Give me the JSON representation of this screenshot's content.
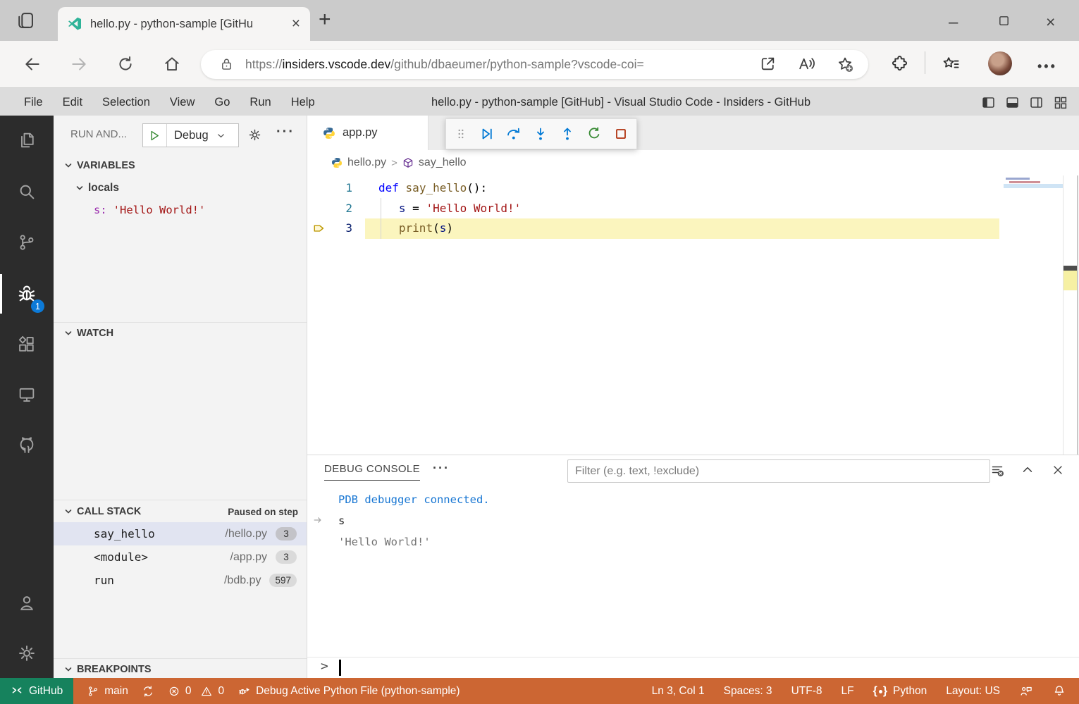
{
  "colors": {
    "status_debugging": "#CC6633",
    "remote_green": "#16825D",
    "badge_blue": "#0C7AD8",
    "current_line_highlight": "#FBF5BE",
    "activity_bar": "#2C2C2C"
  },
  "browser": {
    "tab_title": "hello.py - python-sample [GitHu",
    "new_tab_label": "+",
    "url_scheme": "https://",
    "url_host": "insiders.vscode.dev",
    "url_path": "/github/dbaeumer/python-sample?vscode-coi="
  },
  "titlebar": {
    "menus": [
      "File",
      "Edit",
      "Selection",
      "View",
      "Go",
      "Run",
      "Help"
    ],
    "title": "hello.py - python-sample [GitHub] - Visual Studio Code - Insiders - GitHub"
  },
  "activity_bar": {
    "debug_badge": "1"
  },
  "run_panel": {
    "header_label": "RUN AND...",
    "config_name": "Debug",
    "sections": {
      "variables": "VARIABLES",
      "watch": "WATCH",
      "call_stack": "CALL STACK",
      "breakpoints": "BREAKPOINTS"
    },
    "variables_scope": "locals",
    "variables": [
      {
        "name": "s:",
        "value": "'Hello World!'"
      }
    ],
    "call_stack_status": "Paused on step",
    "frames": [
      {
        "name": "say_hello",
        "file": "/hello.py",
        "line": "3",
        "selected": true
      },
      {
        "name": "<module>",
        "file": "/app.py",
        "line": "3",
        "selected": false
      },
      {
        "name": "run",
        "file": "/bdb.py",
        "line": "597",
        "selected": false
      }
    ]
  },
  "editor": {
    "tab_label": "app.py",
    "breadcrumbs": {
      "file": "hello.py",
      "symbol": "say_hello"
    },
    "code_lines": [
      {
        "num": "1",
        "active": false,
        "tokens": [
          [
            "kw",
            "def"
          ],
          [
            "pl",
            " "
          ],
          [
            "fn",
            "say_hello"
          ],
          [
            "pl",
            "():"
          ]
        ]
      },
      {
        "num": "2",
        "active": false,
        "tokens": [
          [
            "pl",
            "   "
          ],
          [
            "var",
            "s"
          ],
          [
            "pl",
            " = "
          ],
          [
            "str",
            "'Hello World!'"
          ]
        ]
      },
      {
        "num": "3",
        "active": true,
        "tokens": [
          [
            "pl",
            "   "
          ],
          [
            "fn",
            "print"
          ],
          [
            "pl",
            "("
          ],
          [
            "var",
            "s"
          ],
          [
            "pl",
            ")"
          ]
        ]
      }
    ]
  },
  "debug_console": {
    "tab_label": "DEBUG CONSOLE",
    "filter_placeholder": "Filter (e.g. text, !exclude)",
    "lines": [
      {
        "type": "info",
        "text": "PDB debugger connected."
      },
      {
        "type": "input",
        "text": "s"
      },
      {
        "type": "output",
        "text": "'Hello World!'"
      }
    ],
    "prompt": ">"
  },
  "status_bar": {
    "remote_label": "GitHub",
    "branch": "main",
    "errors": "0",
    "warnings": "0",
    "debug_status": "Debug Active Python File (python-sample)",
    "cursor": "Ln 3, Col 1",
    "indent": "Spaces: 3",
    "encoding": "UTF-8",
    "eol": "LF",
    "language": "Python",
    "layout": "Layout: US"
  }
}
